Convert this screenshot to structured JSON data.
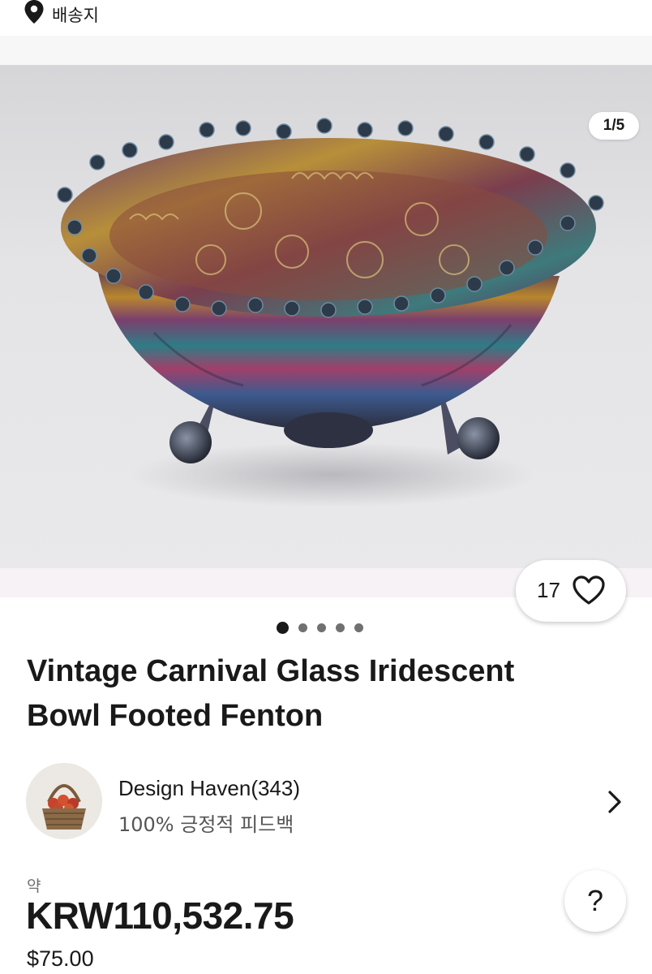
{
  "location_bar": {
    "icon": "location-pin-icon",
    "label": "배송지"
  },
  "carousel": {
    "counter": "1/5",
    "image_alt": "Iridescent carnival glass footed bowl",
    "favorites_count": "17",
    "favorite_icon": "heart-outline-icon",
    "total_slides": 5,
    "active_slide": 1
  },
  "listing": {
    "title": "Vintage Carnival Glass Iridescent Bowl Footed Fenton"
  },
  "seller": {
    "name": "Design Haven(343)",
    "feedback": "100% 긍정적 피드백",
    "chevron_icon": "chevron-right-icon"
  },
  "price": {
    "approx_label": "약",
    "local": "KRW110,532.75",
    "original": "$75.00"
  },
  "help": {
    "label": "?"
  },
  "colors": {
    "text": "#191919",
    "secondary_text": "#555555",
    "page_bg": "#ffffff"
  }
}
